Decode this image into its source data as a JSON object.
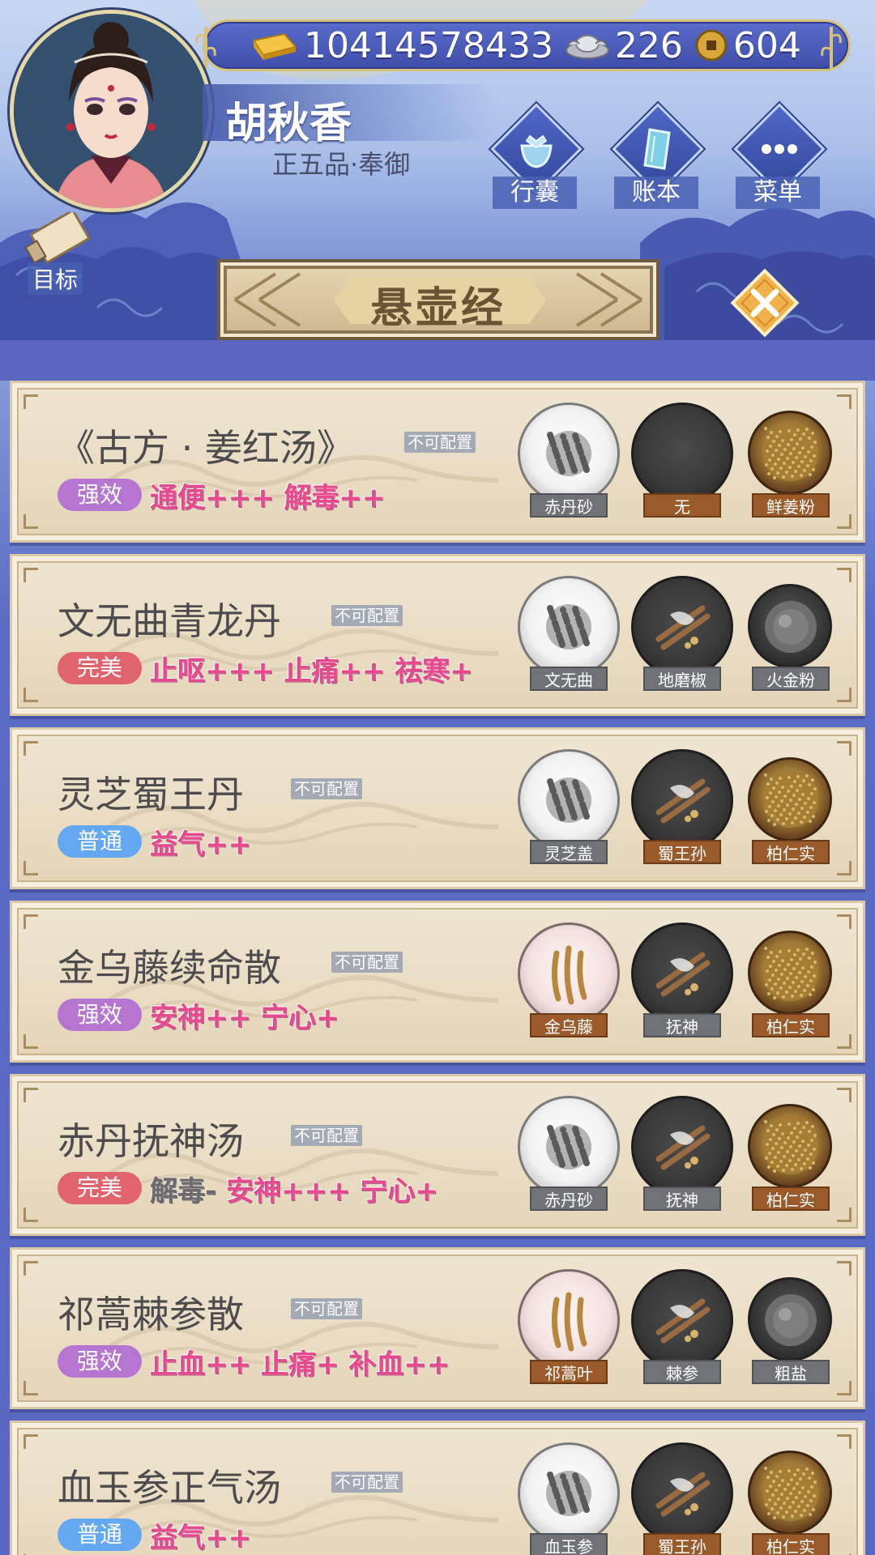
{
  "header": {
    "currencies": [
      {
        "icon": "gold-ingot-icon",
        "value": "10414578433"
      },
      {
        "icon": "silver-ingot-icon",
        "value": "226"
      },
      {
        "icon": "copper-coin-icon",
        "value": "604"
      }
    ],
    "player": {
      "name": "胡秋香",
      "rank": "正五品·奉御"
    },
    "buttons": [
      {
        "label": "行囊",
        "icon": "bag-icon"
      },
      {
        "label": "账本",
        "icon": "ledger-icon"
      },
      {
        "label": "菜单",
        "icon": "menu-dots-icon"
      }
    ],
    "goal_label": "目标",
    "title": "悬壶经"
  },
  "config_tag": "不可配置",
  "recipes": [
    {
      "name": "《古方 · 姜红汤》",
      "quality": "强效",
      "quality_color": "#b575d1",
      "effects": [
        {
          "text": "通便+++",
          "negative": false
        },
        {
          "text": "解毒++",
          "negative": false
        }
      ],
      "ingredients": [
        {
          "label": "赤丹砂",
          "bowl": "white",
          "tag": "grey"
        },
        {
          "label": "无",
          "bowl": "black",
          "tag": "brown"
        },
        {
          "label": "鲜姜粉",
          "bowl": "wood",
          "tag": "brown"
        }
      ]
    },
    {
      "name": "文无曲青龙丹",
      "quality": "完美",
      "quality_color": "#e0636d",
      "effects": [
        {
          "text": "止呕+++",
          "negative": false
        },
        {
          "text": "止痛++",
          "negative": false
        },
        {
          "text": "祛寒+",
          "negative": false
        }
      ],
      "ingredients": [
        {
          "label": "文无曲",
          "bowl": "white",
          "tag": "grey"
        },
        {
          "label": "地磨椒",
          "bowl": "black",
          "tag": "grey"
        },
        {
          "label": "火金粉",
          "bowl": "dark",
          "tag": "grey"
        }
      ]
    },
    {
      "name": "灵芝蜀王丹",
      "quality": "普通",
      "quality_color": "#63a8f1",
      "effects": [
        {
          "text": "益气++",
          "negative": false
        }
      ],
      "ingredients": [
        {
          "label": "灵芝盖",
          "bowl": "white",
          "tag": "grey"
        },
        {
          "label": "蜀王孙",
          "bowl": "black",
          "tag": "brown"
        },
        {
          "label": "柏仁实",
          "bowl": "wood",
          "tag": "brown"
        }
      ]
    },
    {
      "name": "金乌藤续命散",
      "quality": "强效",
      "quality_color": "#b575d1",
      "effects": [
        {
          "text": "安神++",
          "negative": false
        },
        {
          "text": "宁心+",
          "negative": false
        }
      ],
      "ingredients": [
        {
          "label": "金乌藤",
          "bowl": "pink",
          "tag": "brown"
        },
        {
          "label": "抚神",
          "bowl": "black",
          "tag": "grey"
        },
        {
          "label": "柏仁实",
          "bowl": "wood",
          "tag": "brown"
        }
      ]
    },
    {
      "name": "赤丹抚神汤",
      "quality": "完美",
      "quality_color": "#e0636d",
      "effects": [
        {
          "text": "解毒-",
          "negative": true
        },
        {
          "text": "安神+++",
          "negative": false
        },
        {
          "text": "宁心+",
          "negative": false
        }
      ],
      "ingredients": [
        {
          "label": "赤丹砂",
          "bowl": "white",
          "tag": "grey"
        },
        {
          "label": "抚神",
          "bowl": "black",
          "tag": "grey"
        },
        {
          "label": "柏仁实",
          "bowl": "wood",
          "tag": "brown"
        }
      ]
    },
    {
      "name": "祁蒿棘参散",
      "quality": "强效",
      "quality_color": "#b575d1",
      "effects": [
        {
          "text": "止血++",
          "negative": false
        },
        {
          "text": "止痛+",
          "negative": false
        },
        {
          "text": "补血++",
          "negative": false
        }
      ],
      "ingredients": [
        {
          "label": "祁蒿叶",
          "bowl": "pink",
          "tag": "brown"
        },
        {
          "label": "棘参",
          "bowl": "black",
          "tag": "grey"
        },
        {
          "label": "粗盐",
          "bowl": "dark",
          "tag": "grey"
        }
      ]
    },
    {
      "name": "血玉参正气汤",
      "quality": "普通",
      "quality_color": "#63a8f1",
      "effects": [
        {
          "text": "益气++",
          "negative": false
        }
      ],
      "ingredients": [
        {
          "label": "血玉参",
          "bowl": "white",
          "tag": "grey"
        },
        {
          "label": "蜀王孙",
          "bowl": "black",
          "tag": "brown"
        },
        {
          "label": "柏仁实",
          "bowl": "wood",
          "tag": "brown"
        }
      ]
    }
  ]
}
